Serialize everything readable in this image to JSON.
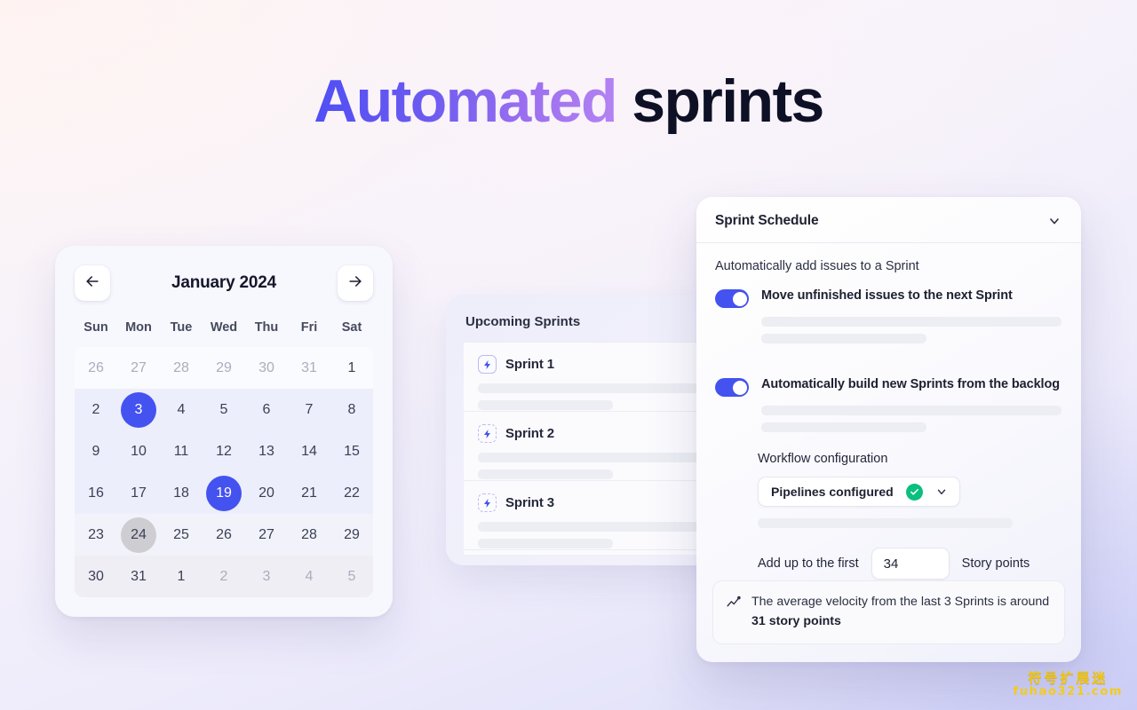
{
  "hero": {
    "accent_text": "Automated",
    "rest_text": " sprints",
    "accent_color": "#5a4ff3",
    "rest_color": "#0e1026"
  },
  "calendar": {
    "title": "January 2024",
    "prev_icon": "arrow-left-icon",
    "next_icon": "arrow-right-icon",
    "weekdays": [
      "Sun",
      "Mon",
      "Tue",
      "Wed",
      "Thu",
      "Fri",
      "Sat"
    ],
    "selected_color": "#4452ef",
    "hover_color": "#cdcdd2",
    "rows": [
      {
        "tint": "tint-a",
        "days": [
          {
            "label": "26",
            "state": "muted"
          },
          {
            "label": "27",
            "state": "muted"
          },
          {
            "label": "28",
            "state": "muted"
          },
          {
            "label": "29",
            "state": "muted"
          },
          {
            "label": "30",
            "state": "muted"
          },
          {
            "label": "31",
            "state": "muted"
          },
          {
            "label": "1",
            "state": "normal"
          }
        ]
      },
      {
        "tint": "tint-b",
        "days": [
          {
            "label": "2",
            "state": "normal"
          },
          {
            "label": "3",
            "state": "selected"
          },
          {
            "label": "4",
            "state": "normal"
          },
          {
            "label": "5",
            "state": "normal"
          },
          {
            "label": "6",
            "state": "normal"
          },
          {
            "label": "7",
            "state": "normal"
          },
          {
            "label": "8",
            "state": "normal"
          }
        ]
      },
      {
        "tint": "tint-b",
        "days": [
          {
            "label": "9",
            "state": "normal"
          },
          {
            "label": "10",
            "state": "normal"
          },
          {
            "label": "11",
            "state": "normal"
          },
          {
            "label": "12",
            "state": "normal"
          },
          {
            "label": "13",
            "state": "normal"
          },
          {
            "label": "14",
            "state": "normal"
          },
          {
            "label": "15",
            "state": "normal"
          }
        ]
      },
      {
        "tint": "tint-b",
        "days": [
          {
            "label": "16",
            "state": "normal"
          },
          {
            "label": "17",
            "state": "normal"
          },
          {
            "label": "18",
            "state": "normal"
          },
          {
            "label": "19",
            "state": "selected"
          },
          {
            "label": "20",
            "state": "normal"
          },
          {
            "label": "21",
            "state": "normal"
          },
          {
            "label": "22",
            "state": "normal"
          }
        ]
      },
      {
        "tint": "tint-c",
        "days": [
          {
            "label": "23",
            "state": "normal"
          },
          {
            "label": "24",
            "state": "hover"
          },
          {
            "label": "25",
            "state": "normal"
          },
          {
            "label": "26",
            "state": "normal"
          },
          {
            "label": "27",
            "state": "normal"
          },
          {
            "label": "28",
            "state": "normal"
          },
          {
            "label": "29",
            "state": "normal"
          }
        ]
      },
      {
        "tint": "tint-d",
        "days": [
          {
            "label": "30",
            "state": "normal"
          },
          {
            "label": "31",
            "state": "normal"
          },
          {
            "label": "1",
            "state": "normal"
          },
          {
            "label": "2",
            "state": "muted"
          },
          {
            "label": "3",
            "state": "muted"
          },
          {
            "label": "4",
            "state": "muted"
          },
          {
            "label": "5",
            "state": "muted"
          }
        ]
      }
    ]
  },
  "sprints_panel": {
    "title": "Upcoming Sprints",
    "items": [
      {
        "name": "Sprint 1",
        "icon": "lightning-bolt-icon",
        "icon_border": "solid"
      },
      {
        "name": "Sprint 2",
        "icon": "lightning-bolt-icon",
        "icon_border": "dashed"
      },
      {
        "name": "Sprint 3",
        "icon": "lightning-bolt-icon",
        "icon_border": "dashed"
      }
    ]
  },
  "schedule_panel": {
    "title": "Sprint Schedule",
    "collapse_icon": "chevron-down-icon",
    "section_label": "Automatically add issues to a Sprint",
    "toggles": [
      {
        "label": "Move unfinished issues to the next Sprint",
        "on": true
      },
      {
        "label": "Automatically build new Sprints from the backlog",
        "on": true
      }
    ],
    "workflow": {
      "label": "Workflow configuration",
      "select_value": "Pipelines configured",
      "status_icon": "check-circle-icon",
      "status_color": "#0bbf7e",
      "dropdown_icon": "chevron-down-icon"
    },
    "story_points": {
      "prefix_label": "Add up to the first",
      "value": "34",
      "suffix_label": "Story points"
    },
    "note": {
      "icon": "trend-line-icon",
      "text_part1": "The average velocity from the last 3 Sprints is around ",
      "text_bold": "31 story points"
    }
  },
  "watermark": {
    "cn": "符号扩展迷",
    "en": "fuhao321.com",
    "color": "#f0c40a"
  }
}
